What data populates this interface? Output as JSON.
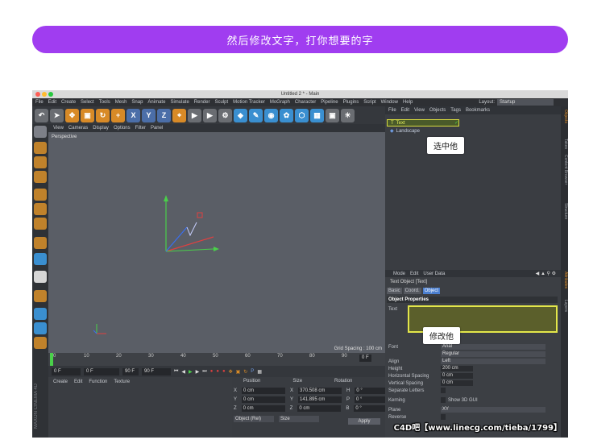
{
  "banner": {
    "text": "然后修改文字，打你想要的字",
    "color": "#a03df0"
  },
  "window": {
    "title": "Untitled 2 * - Main"
  },
  "menu": [
    "File",
    "Edit",
    "Create",
    "Select",
    "Tools",
    "Mesh",
    "Snap",
    "Animate",
    "Simulate",
    "Render",
    "Sculpt",
    "Motion Tracker",
    "MoGraph",
    "Character",
    "Pipeline",
    "Plugins",
    "Script",
    "Window",
    "Help"
  ],
  "layout": {
    "label": "Layout:",
    "value": "Startup"
  },
  "viewport": {
    "menu": [
      "View",
      "Cameras",
      "Display",
      "Options",
      "Filter",
      "Panel"
    ],
    "label": "Perspective",
    "grid_spacing": "Grid Spacing : 100 cm"
  },
  "timeline": {
    "ticks": [
      "0",
      "10",
      "20",
      "30",
      "40",
      "50",
      "60",
      "70",
      "80",
      "90"
    ],
    "current_frame": "0 F",
    "start": "0 F",
    "end": "90 F",
    "end2": "90 F",
    "frame_right": "0 F"
  },
  "bottom": {
    "menu": [
      "Create",
      "Edit",
      "Function",
      "Texture"
    ],
    "brand": "MAXON CINEMA 4D"
  },
  "coords": {
    "headers": [
      "Position",
      "Size",
      "Rotation"
    ],
    "rows": [
      {
        "axis": "X",
        "pos": "0 cm",
        "saxis": "X",
        "size": "370.508 cm",
        "raxis": "H",
        "rot": "0 °"
      },
      {
        "axis": "Y",
        "pos": "0 cm",
        "saxis": "Y",
        "size": "141.895 cm",
        "raxis": "P",
        "rot": "0 °"
      },
      {
        "axis": "Z",
        "pos": "0 cm",
        "saxis": "Z",
        "size": "0 cm",
        "raxis": "B",
        "rot": "0 °"
      }
    ],
    "mode": "Object (Rel)",
    "size_mode": "Size",
    "apply": "Apply"
  },
  "objects": {
    "menu": [
      "File",
      "Edit",
      "View",
      "Objects",
      "Tags",
      "Bookmarks"
    ],
    "items": [
      "Text",
      "Landscape"
    ]
  },
  "right_tabs": [
    "Objects",
    "Takes",
    "Content Browser",
    "Structure",
    "Attributes",
    "Layers"
  ],
  "attributes": {
    "menu": [
      "Mode",
      "Edit",
      "User Data"
    ],
    "title": "Text Object [Text]",
    "tabs": [
      "Basic",
      "Coord.",
      "Object"
    ],
    "section": "Object Properties",
    "text_label": "Text",
    "props": [
      {
        "label": "Font",
        "value": "Arial"
      },
      {
        "label": "",
        "value": "Regular"
      },
      {
        "label": "Align",
        "value": "Left"
      },
      {
        "label": "Height",
        "value": "200 cm"
      },
      {
        "label": "Horizontal Spacing",
        "value": "0 cm"
      },
      {
        "label": "Vertical Spacing",
        "value": "0 cm"
      },
      {
        "label": "Separate Letters",
        "value": ""
      },
      {
        "label": "Kerning",
        "value": "Show 3D GUI"
      },
      {
        "label": "Plane",
        "value": "XY"
      },
      {
        "label": "Reverse",
        "value": ""
      }
    ]
  },
  "callouts": {
    "select": "选中他",
    "modify": "修改他"
  },
  "watermark": "C4D吧【www.linecg.com/tieba/1799】"
}
